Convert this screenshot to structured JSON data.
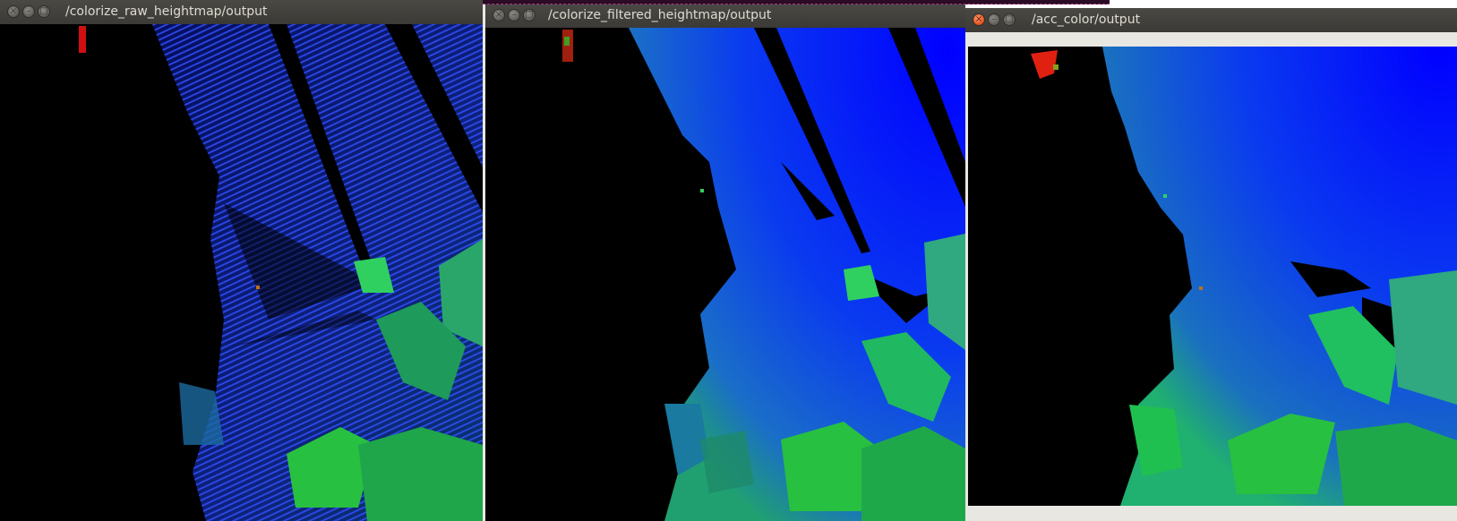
{
  "windows": [
    {
      "title": "/colorize_raw_heightmap/output",
      "active": false
    },
    {
      "title": "/colorize_filtered_heightmap/output",
      "active": false
    },
    {
      "title": "/acc_color/output",
      "active": true
    }
  ],
  "titlebar_buttons": {
    "close": "×",
    "minimize": "–",
    "maximize": "□"
  },
  "colors": {
    "titlebar": "#3c3b37",
    "title_text": "#dfdbd2",
    "background": "#000000",
    "height_low": "#0000ff",
    "height_mid": "#00ff00",
    "height_high": "#ff0000",
    "frame_light": "#e9e7e2"
  }
}
